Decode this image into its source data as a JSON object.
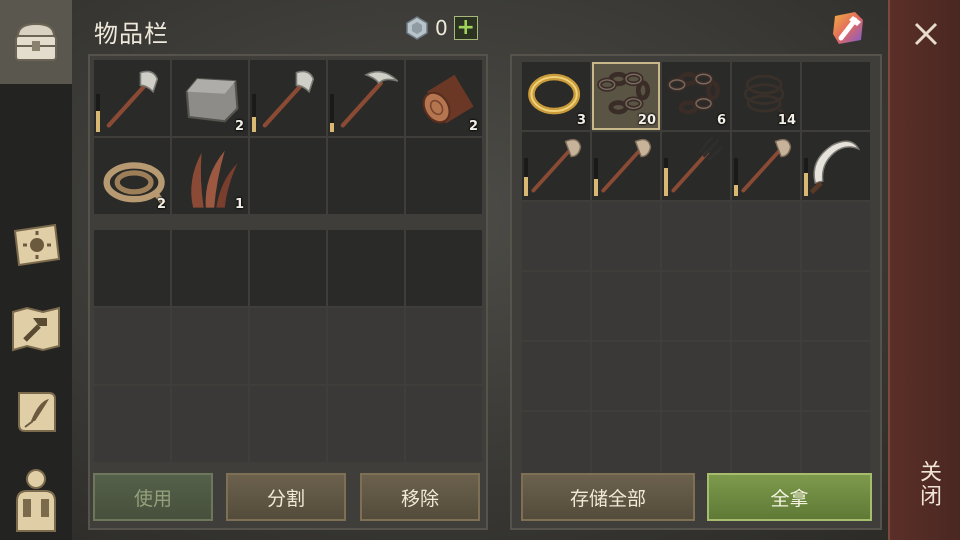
{
  "header": {
    "title": "物品栏",
    "gem_count": "0",
    "add_label": "+"
  },
  "sidebar": {
    "tabs": [
      "chest-icon",
      "sun-book-icon",
      "crafting-map-icon",
      "quest-scroll-icon",
      "character-icon"
    ]
  },
  "inventory": {
    "items": [
      {
        "icon": "stone-axe-icon",
        "qty": "",
        "durability": 0.55
      },
      {
        "icon": "stone-block-icon",
        "qty": "2"
      },
      {
        "icon": "stone-axe-icon",
        "qty": "",
        "durability": 0.4
      },
      {
        "icon": "stone-pickaxe-icon",
        "qty": "",
        "durability": 0.25
      },
      {
        "icon": "log-icon",
        "qty": "2"
      },
      {
        "icon": "rope-icon",
        "qty": "2"
      },
      {
        "icon": "plant-fiber-icon",
        "qty": "1"
      }
    ]
  },
  "storage": {
    "items": [
      {
        "icon": "gold-ring-icon",
        "qty": "3"
      },
      {
        "icon": "chain-icon",
        "qty": "20",
        "selected": true
      },
      {
        "icon": "chain-icon",
        "qty": "6"
      },
      {
        "icon": "wire-icon",
        "qty": "14"
      },
      {
        "icon": "",
        "qty": ""
      },
      {
        "icon": "shovel-icon",
        "qty": "",
        "durability": 0.5
      },
      {
        "icon": "shovel-icon",
        "qty": "",
        "durability": 0.45
      },
      {
        "icon": "pitchfork-icon",
        "qty": "",
        "durability": 0.75
      },
      {
        "icon": "shovel-icon",
        "qty": "",
        "durability": 0.3
      },
      {
        "icon": "sickle-icon",
        "qty": "",
        "durability": 0.6
      }
    ]
  },
  "buttons": {
    "use": "使用",
    "split": "分割",
    "remove": "移除",
    "store_all": "存储全部",
    "take_all": "全拿"
  },
  "close": {
    "label": "关闭"
  },
  "colors": {
    "accent_green": "#7d9a4c",
    "durability": "#d9b874",
    "close_bg": "#5b2f28"
  }
}
